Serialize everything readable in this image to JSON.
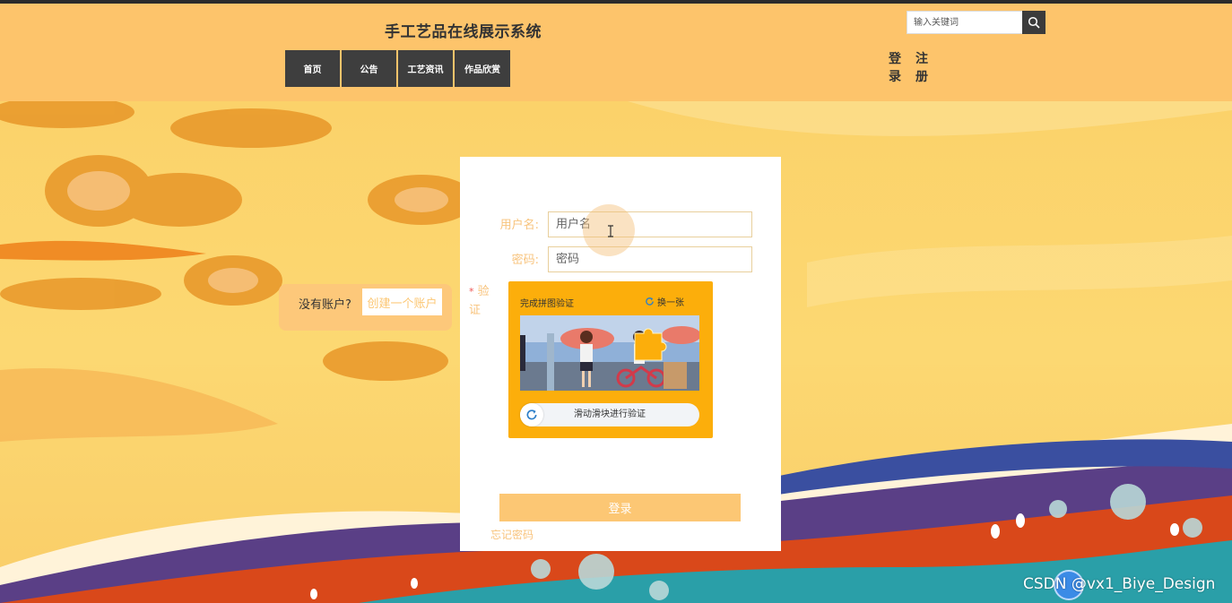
{
  "header": {
    "site_title": "手工艺品在线展示系统",
    "search": {
      "placeholder": "输入关键词",
      "icon": "search-icon"
    },
    "nav": [
      "首页",
      "公告",
      "工艺资讯",
      "作品欣赏"
    ],
    "login_link": "登录",
    "register_link": "注册"
  },
  "side_panel": {
    "no_account": "没有账户?",
    "create_account": "创建一个账户"
  },
  "login_form": {
    "username_label": "用户名:",
    "username_placeholder": "用户名",
    "password_label": "密码:",
    "password_placeholder": "密码",
    "verify_label": "验证",
    "required_mark": "*",
    "captcha": {
      "title": "完成拼图验证",
      "refresh_label": "换一张",
      "slider_hint": "滑动滑块进行验证"
    },
    "submit_label": "登录",
    "forgot_label": "忘记密码"
  },
  "watermark": "CSDN @vx1_Biye_Design",
  "colors": {
    "header_bg": "#fdc46b",
    "nav_bg": "#3e3e3e",
    "accent": "#fcc774",
    "captcha_bg": "#fcae0b"
  }
}
